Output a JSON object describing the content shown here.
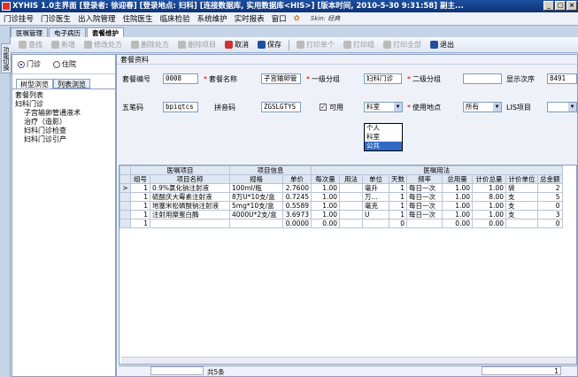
{
  "window": {
    "title": "XYHIS 1.0主界面 [登录者: 徐迎春] [登录地点: 妇科] [连接数据库, 实用数据库<HIS>] [版本时间, 2010-5-30 9:31:58] 副主...",
    "buttons": [
      "_",
      "□",
      "×"
    ]
  },
  "menu": {
    "items": [
      "门诊挂号",
      "门诊医生",
      "出入院管理",
      "住院医生",
      "临床检验",
      "系统维护",
      "实时报表",
      "窗口",
      "Skin: 经典"
    ]
  },
  "tabs": [
    "医嘱管理",
    "电子病历",
    "套餐维护"
  ],
  "sidebar_strip": {
    "label": "功能切换"
  },
  "toolbar": {
    "buttons": [
      {
        "label": "查找",
        "enabled": false,
        "color": "#a0a0a0"
      },
      {
        "label": "新增",
        "enabled": false,
        "color": "#a0a0a0"
      },
      {
        "label": "修改处方",
        "enabled": false,
        "color": "#a0a0a0"
      },
      {
        "label": "删除处方",
        "enabled": false,
        "color": "#a0a0a0"
      },
      {
        "label": "删除项目",
        "enabled": false,
        "color": "#a0a0a0"
      },
      {
        "label": "取消",
        "enabled": true,
        "color": "#d03030"
      },
      {
        "label": "保存",
        "enabled": true,
        "color": "#2050a0"
      },
      {
        "label": "打印单个",
        "enabled": false,
        "color": "#a0a0a0"
      },
      {
        "label": "打印组",
        "enabled": false,
        "color": "#a0a0a0"
      },
      {
        "label": "打印全部",
        "enabled": false,
        "color": "#a0a0a0"
      },
      {
        "label": "退出",
        "enabled": true,
        "color": "#2050a0"
      }
    ]
  },
  "left": {
    "radios": [
      {
        "label": "门诊",
        "selected": true
      },
      {
        "label": "住院",
        "selected": false
      }
    ],
    "subtabs": [
      "树型浏览",
      "列表浏览"
    ],
    "tree_root": "套餐列表",
    "tree_group": "妇科门诊",
    "tree_items": [
      "子宫输卵管通液术",
      "治疗（造影）",
      "妇科门诊检查",
      "妇科门诊引产"
    ]
  },
  "form": {
    "section_title": "套餐资料",
    "fields": {
      "code_label": "套餐编号",
      "code_value": "0008",
      "name_label": "套餐名称",
      "name_value": "子宫输卵管",
      "cat1_label": "一级分组",
      "cat1_value": "妇科门诊",
      "cat2_label": "二级分组",
      "cat2_value": "",
      "order_label": "显示次序",
      "order_value": "8491",
      "wubi_label": "五笔码",
      "wubi_value": "bpiqtcs",
      "pinyin_label": "拼音码",
      "pinyin_value": "ZGSLGTYS",
      "usable_label": "可用",
      "dept_value": "科室",
      "place_label": "使用地点",
      "place_value": "所有",
      "lis_label": "LIS项目",
      "lis_value": ""
    },
    "dropdown_options": [
      "个人",
      "科室",
      "公共"
    ],
    "dropdown_highlight": "公共"
  },
  "grid": {
    "group_headers": [
      "医嘱项目",
      "项目信息",
      "医嘱用法"
    ],
    "columns": [
      "组号",
      "项目名称",
      "规格",
      "单价",
      "每次量",
      "用法",
      "单位",
      "天数",
      "频率",
      "总用量",
      "计价总量",
      "计价单位",
      "总金额"
    ],
    "rows": [
      [
        "1",
        "0.9%氯化钠注射液",
        "100ml/瓶",
        "2.7600",
        "1.00",
        "",
        "毫升",
        "1",
        "每日一次",
        "1.00",
        "1.00",
        "袋",
        "2"
      ],
      [
        "1",
        "硫酸庆大霉素注射液",
        "8万U*10支/盒",
        "0.7245",
        "1.00",
        "",
        "万...",
        "1",
        "每日一次",
        "1.00",
        "8.00",
        "支",
        "5"
      ],
      [
        "1",
        "地塞米松磷酸钠注射液",
        "5mg*10支/盒",
        "0.5589",
        "1.00",
        "",
        "毫克",
        "1",
        "每日一次",
        "1.00",
        "1.00",
        "支",
        "0"
      ],
      [
        "1",
        "注射用糜蛋白酶",
        "4000U*2支/盒",
        "3.6973",
        "1.00",
        "",
        "U",
        "1",
        "每日一次",
        "1.00",
        "1.00",
        "支",
        "3"
      ],
      [
        "1",
        "",
        "",
        "0.0000",
        "0.00",
        "",
        "",
        "0",
        "",
        "0.00",
        "0.00",
        "",
        "0"
      ]
    ],
    "status_count": "共5条",
    "status_total": "1"
  }
}
